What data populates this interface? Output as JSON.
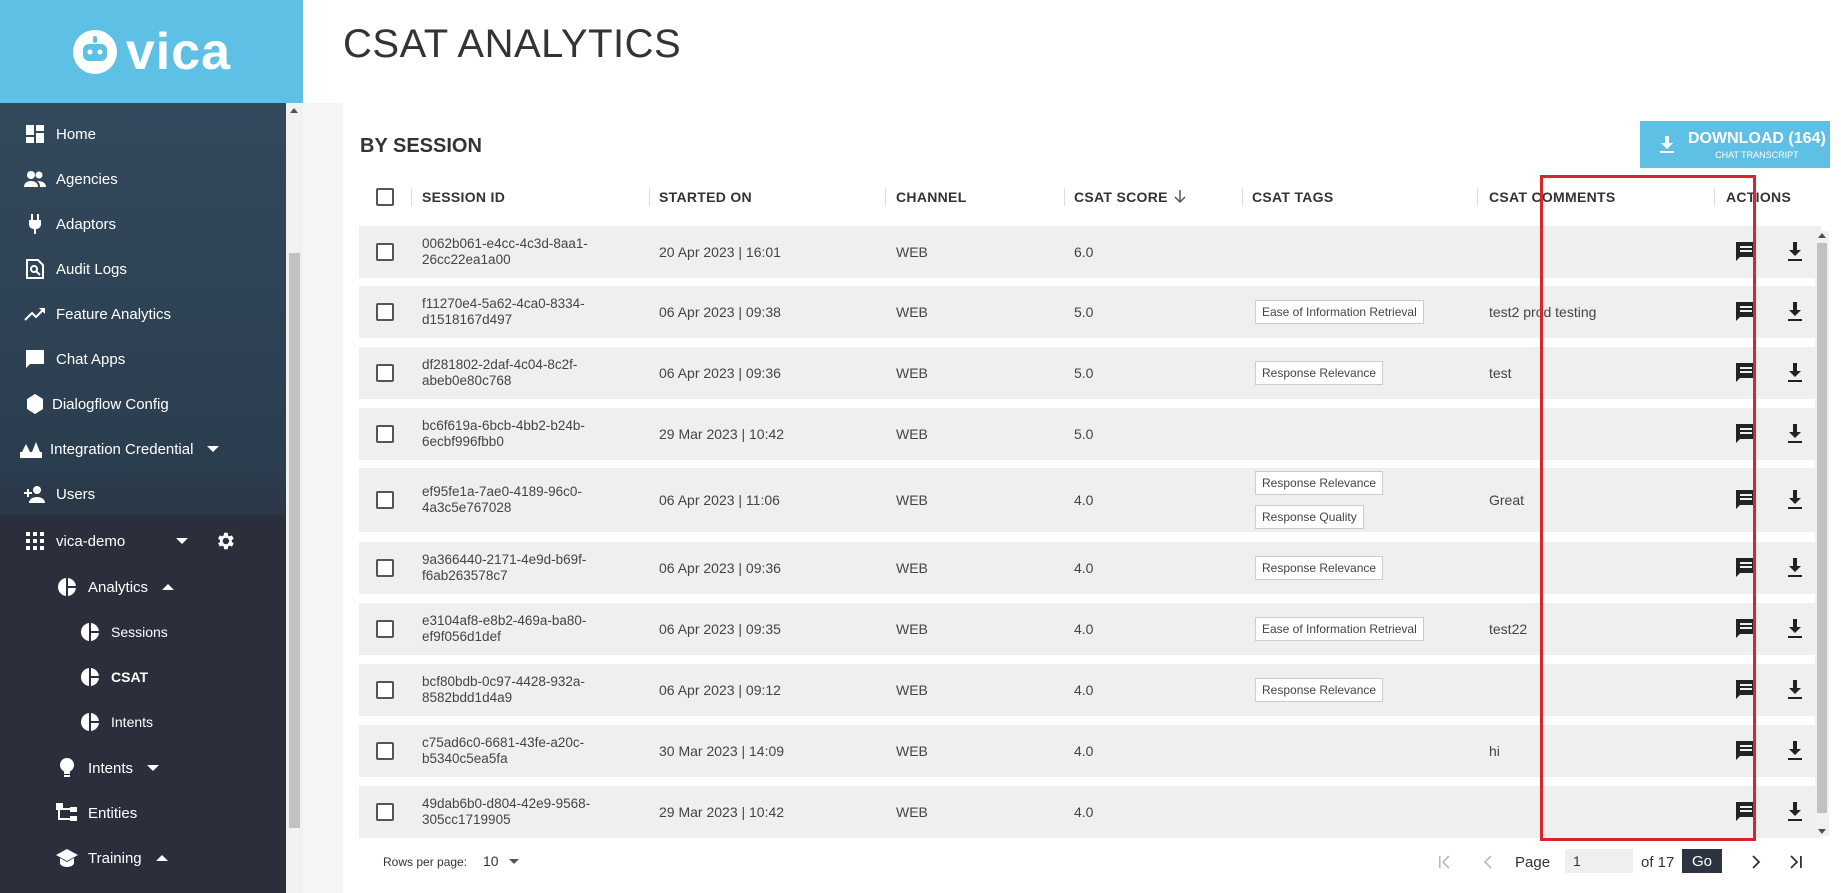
{
  "brand": {
    "name": "vica",
    "color": "#5ec0e4"
  },
  "nav": {
    "items": [
      {
        "label": "Home",
        "icon": "dashboard-icon"
      },
      {
        "label": "Agencies",
        "icon": "people-icon"
      },
      {
        "label": "Adaptors",
        "icon": "plug-icon"
      },
      {
        "label": "Audit Logs",
        "icon": "search-doc-icon"
      },
      {
        "label": "Feature Analytics",
        "icon": "trending-icon"
      },
      {
        "label": "Chat Apps",
        "icon": "chat-icon"
      },
      {
        "label": "Dialogflow Config",
        "icon": "hexagon-icon"
      },
      {
        "label": "Integration Credential",
        "icon": "integration-icon"
      },
      {
        "label": "Users",
        "icon": "add-user-icon"
      }
    ],
    "project": {
      "label": "vica-demo"
    },
    "analytics": {
      "label": "Analytics",
      "children": [
        "Sessions",
        "CSAT",
        "Intents"
      ]
    },
    "intents": {
      "label": "Intents"
    },
    "entities": {
      "label": "Entities"
    },
    "training": {
      "label": "Training"
    }
  },
  "page": {
    "title": "CSAT ANALYTICS",
    "section": "BY SESSION"
  },
  "download": {
    "label": "DOWNLOAD (164)",
    "sub": "CHAT TRANSCRIPT"
  },
  "table": {
    "columns": [
      "SESSION ID",
      "STARTED ON",
      "CHANNEL",
      "CSAT SCORE",
      "CSAT TAGS",
      "CSAT COMMENTS",
      "ACTIONS"
    ],
    "rows": [
      {
        "session_id": "0062b061-e4cc-4c3d-8aa1-26cc22ea1a00",
        "started_on": "20 Apr 2023 | 16:01",
        "channel": "WEB",
        "score": "6.0",
        "tags": [],
        "comment": ""
      },
      {
        "session_id": "f11270e4-5a62-4ca0-8334-d1518167d497",
        "started_on": "06 Apr 2023 | 09:38",
        "channel": "WEB",
        "score": "5.0",
        "tags": [
          "Ease of Information Retrieval"
        ],
        "comment": "test2 prod testing"
      },
      {
        "session_id": "df281802-2daf-4c04-8c2f-abeb0e80c768",
        "started_on": "06 Apr 2023 | 09:36",
        "channel": "WEB",
        "score": "5.0",
        "tags": [
          "Response Relevance"
        ],
        "comment": "test"
      },
      {
        "session_id": "bc6f619a-6bcb-4bb2-b24b-6ecbf996fbb0",
        "started_on": "29 Mar 2023 | 10:42",
        "channel": "WEB",
        "score": "5.0",
        "tags": [],
        "comment": ""
      },
      {
        "session_id": "ef95fe1a-7ae0-4189-96c0-4a3c5e767028",
        "started_on": "06 Apr 2023 | 11:06",
        "channel": "WEB",
        "score": "4.0",
        "tags": [
          "Response Relevance",
          "Response Quality"
        ],
        "comment": "Great"
      },
      {
        "session_id": "9a366440-2171-4e9d-b69f-f6ab263578c7",
        "started_on": "06 Apr 2023 | 09:36",
        "channel": "WEB",
        "score": "4.0",
        "tags": [
          "Response Relevance"
        ],
        "comment": ""
      },
      {
        "session_id": "e3104af8-e8b2-469a-ba80-ef9f056d1def",
        "started_on": "06 Apr 2023 | 09:35",
        "channel": "WEB",
        "score": "4.0",
        "tags": [
          "Ease of Information Retrieval"
        ],
        "comment": "test22"
      },
      {
        "session_id": "bcf80bdb-0c97-4428-932a-8582bdd1d4a9",
        "started_on": "06 Apr 2023 | 09:12",
        "channel": "WEB",
        "score": "4.0",
        "tags": [
          "Response Relevance"
        ],
        "comment": ""
      },
      {
        "session_id": "c75ad6c0-6681-43fe-a20c-b5340c5ea5fa",
        "started_on": "30 Mar 2023 | 14:09",
        "channel": "WEB",
        "score": "4.0",
        "tags": [],
        "comment": "hi"
      },
      {
        "session_id": "49dab6b0-d804-42e9-9568-305cc1719905",
        "started_on": "29 Mar 2023 | 10:42",
        "channel": "WEB",
        "score": "4.0",
        "tags": [],
        "comment": ""
      }
    ]
  },
  "pagination": {
    "rows_label": "Rows per page:",
    "rows_value": "10",
    "page_label": "Page",
    "page_value": "1",
    "of_label": "of 17",
    "go_label": "Go"
  },
  "colors": {
    "highlight": "#d9232d",
    "row_bg": "#efefef",
    "dark_button": "#2c3443"
  }
}
